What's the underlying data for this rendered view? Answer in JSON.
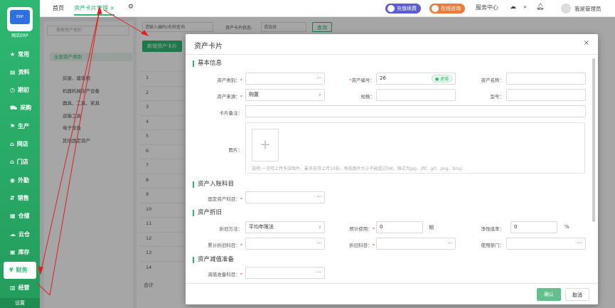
{
  "sidebar": {
    "logo_text": "网店ERP",
    "items": [
      {
        "label": "常用",
        "icon": "star-icon"
      },
      {
        "label": "资料",
        "icon": "document-icon"
      },
      {
        "label": "期初",
        "icon": "clock-icon"
      },
      {
        "label": "采购",
        "icon": "cart-icon"
      },
      {
        "label": "生产",
        "icon": "factory-icon"
      },
      {
        "label": "网店",
        "icon": "shop-icon"
      },
      {
        "label": "门店",
        "icon": "store-icon"
      },
      {
        "label": "外勤",
        "icon": "location-icon"
      },
      {
        "label": "销售",
        "icon": "sales-icon"
      },
      {
        "label": "仓储",
        "icon": "warehouse-icon"
      },
      {
        "label": "云仓",
        "icon": "cloud-icon"
      },
      {
        "label": "库存",
        "icon": "box-icon"
      },
      {
        "label": "财务",
        "icon": "finance-icon"
      },
      {
        "label": "经营",
        "icon": "chart-icon"
      }
    ],
    "settings": "设置",
    "active_index": 12
  },
  "topbar": {
    "tabs": [
      "首页",
      "资产卡片管理"
    ],
    "recharge": "充值续费",
    "online": "在线咨询",
    "service": "服务中心",
    "user": "我是管理员"
  },
  "left_panel": {
    "search_placeholder": "搜索资产类别",
    "root": "全部资产类别",
    "items": [
      "房屋、建筑物",
      "机器机械生产设备",
      "器具、工具、家具",
      "运输工具",
      "电子设备",
      "其他固定资产"
    ]
  },
  "main": {
    "filter_placeholder": "请输入编码/名称查询",
    "status_label": "资产卡片状态:",
    "status_placeholder": "请选择",
    "query": "查询",
    "add_button": "新增资产卡片",
    "row_numbers": [
      "1",
      "2",
      "3",
      "4",
      "5",
      "6",
      "7",
      "8",
      "9",
      "10",
      "11",
      "12",
      "13",
      "14"
    ],
    "total_label": "合计"
  },
  "modal": {
    "title": "资产卡片",
    "sections": {
      "basic": "基本信息",
      "account": "资产入账科目",
      "depreciation": "资产折旧",
      "impairment": "资产减值准备"
    },
    "fields": {
      "asset_category": "资产类别",
      "asset_code": "资产编号",
      "asset_code_value": "26",
      "asset_code_tag": "● 递增",
      "asset_name": "资产名称",
      "asset_source": "资产来源",
      "asset_source_value": "购置",
      "spec": "规格",
      "model": "型号",
      "remark": "卡片备注",
      "image": "图片",
      "image_hint": "说明:一次可上传多张图片，最多支持上传10张。每张图片大小不能超过5M，格式为jpg、jfif、gif、png、bmp",
      "fixed_asset_account": "固定资产科目",
      "depreciation_method": "折旧方法",
      "depreciation_method_value": "平均年限法",
      "expected_use": "预计使用",
      "expected_use_value": "0",
      "period_unit": "期",
      "residual_rate": "净残值率",
      "residual_rate_value": "0",
      "percent": "%",
      "acc_dep_account": "累计折旧科目",
      "dep_account": "折旧科目",
      "use_dept": "使用部门",
      "impairment_account": "减值准备科目"
    },
    "ok": "确认",
    "cancel": "取消"
  }
}
